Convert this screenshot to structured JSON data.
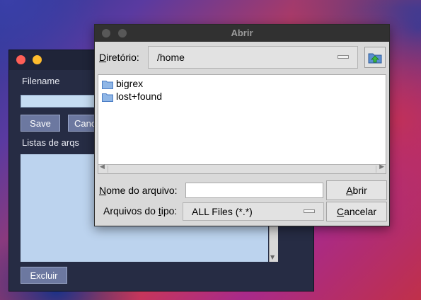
{
  "background_window": {
    "filename_label": "Filename",
    "save_label": "Save",
    "cancel_label": "Canc",
    "list_label": "Listas de arqs",
    "delete_label": "Excluir"
  },
  "dialog": {
    "title": "Abrir",
    "directory_label_mnemonic": "D",
    "directory_label_rest": "iretório:",
    "directory_value": "/home",
    "files": [
      {
        "name": "bigrex",
        "icon": "folder-icon"
      },
      {
        "name": "lost+found",
        "icon": "folder-icon"
      }
    ],
    "filename_label_mnemonic": "N",
    "filename_label_rest": "ome do arquivo:",
    "filename_value": "",
    "open_label_mnemonic": "A",
    "open_label_rest": "brir",
    "filetype_label_before": "Arquivos do ",
    "filetype_label_mnemonic": "t",
    "filetype_label_after": "ipo:",
    "filetype_value": "ALL Files (*.*)",
    "cancel_label_mnemonic": "C",
    "cancel_label_rest": "ancelar"
  },
  "colors": {
    "dialog_bg": "#d9d9d9",
    "dialog_titlebar": "#313131",
    "folder_icon": "#4a7cc4",
    "bg_window": "#262c44",
    "bg_button": "#6c78a0",
    "list_bg": "#bcd3ee"
  }
}
